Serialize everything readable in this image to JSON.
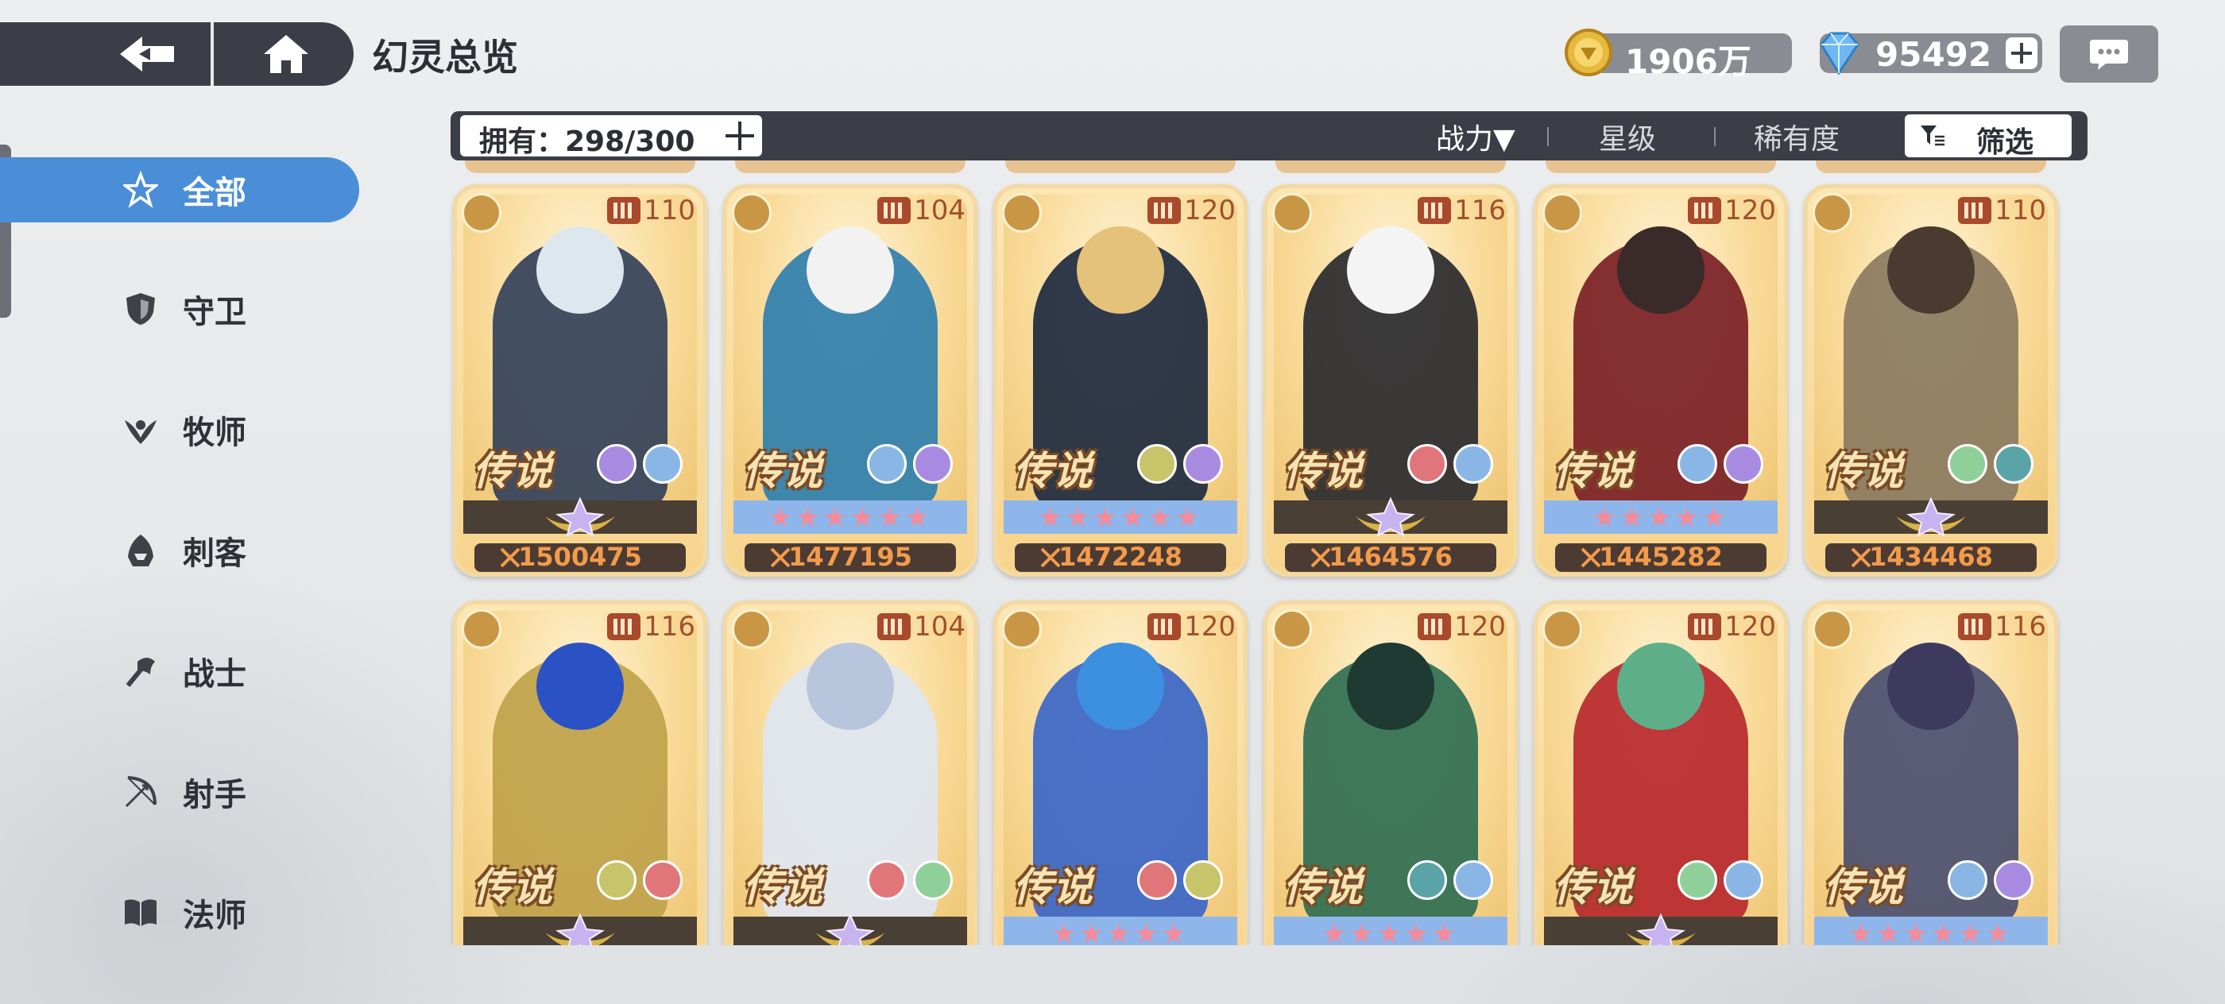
{
  "header": {
    "title": "幻灵总览",
    "gold": "1906万",
    "gems": "95492"
  },
  "sidebar": {
    "items": [
      {
        "label": "全部",
        "icon": "all-icon",
        "active": true
      },
      {
        "label": "守卫",
        "icon": "shield-icon",
        "active": false
      },
      {
        "label": "牧师",
        "icon": "priest-icon",
        "active": false
      },
      {
        "label": "刺客",
        "icon": "assassin-icon",
        "active": false
      },
      {
        "label": "战士",
        "icon": "axe-icon",
        "active": false
      },
      {
        "label": "射手",
        "icon": "bow-icon",
        "active": false
      },
      {
        "label": "法师",
        "icon": "book-icon",
        "active": false
      }
    ]
  },
  "filterbar": {
    "owned": "拥有：298/300",
    "sort_power": "战力▼",
    "sort_star": "星级",
    "sort_rarity": "稀有度",
    "filter": "筛选"
  },
  "cards": [
    {
      "level": "110",
      "rarity": "传说",
      "power": "1500475",
      "class_icon": "priest-icon",
      "tier": "emblem",
      "hair": "#dfe7ee",
      "outfit": "#33415a",
      "elements": [
        "#a88be0",
        "#8ab6e6"
      ]
    },
    {
      "level": "104",
      "rarity": "传说",
      "power": "1477195",
      "class_icon": "shield-icon",
      "tier": "blue",
      "stars": "★★★★★★",
      "hair": "#f2f2f2",
      "outfit": "#2f7fae",
      "elements": [
        "#8ab6e6",
        "#a88be0"
      ]
    },
    {
      "level": "120",
      "rarity": "传说",
      "power": "1472248",
      "class_icon": "axe-icon",
      "tier": "blue",
      "stars": "★★★★★★",
      "hair": "#e4c27a",
      "outfit": "#1e2a3f",
      "elements": [
        "#c8c46a",
        "#a88be0"
      ]
    },
    {
      "level": "116",
      "rarity": "传说",
      "power": "1464576",
      "class_icon": "assassin-icon",
      "tier": "emblem",
      "hair": "#f4f4f4",
      "outfit": "#2a2a2e",
      "elements": [
        "#e0767a",
        "#8ab6e6"
      ]
    },
    {
      "level": "120",
      "rarity": "传说",
      "power": "1445282",
      "class_icon": "bow-icon",
      "tier": "blue",
      "stars": "★★★★★",
      "hair": "#3a2a2a",
      "outfit": "#7a1f26",
      "elements": [
        "#8ab6e6",
        "#a88be0"
      ]
    },
    {
      "level": "110",
      "rarity": "传说",
      "power": "1434468",
      "class_icon": "priest-icon",
      "tier": "emblem",
      "hair": "#4a3a30",
      "outfit": "#8a7a60",
      "elements": [
        "#8fcf9a",
        "#5aa3a6"
      ]
    },
    {
      "level": "116",
      "rarity": "传说",
      "class_icon": "assassin-icon",
      "tier": "emblem",
      "hair": "#2b52c4",
      "outfit": "#bfa24a",
      "elements": [
        "#c8c46a",
        "#e0767a"
      ]
    },
    {
      "level": "104",
      "rarity": "传说",
      "class_icon": "shield-icon",
      "tier": "emblem",
      "hair": "#b7c6dc",
      "outfit": "#dfe6f0",
      "elements": [
        "#e0767a",
        "#8fcf9a"
      ]
    },
    {
      "level": "120",
      "rarity": "传说",
      "class_icon": "book-icon",
      "tier": "blue",
      "stars": "★★★★★",
      "hair": "#3d8fe0",
      "outfit": "#3a66c8",
      "elements": [
        "#e0767a",
        "#c8c46a"
      ]
    },
    {
      "level": "120",
      "rarity": "传说",
      "class_icon": "axe-icon",
      "tier": "blue",
      "stars": "★★★★★",
      "hair": "#1f3a33",
      "outfit": "#2f6e52",
      "elements": [
        "#5aa3a6",
        "#8ab6e6"
      ]
    },
    {
      "level": "120",
      "rarity": "传说",
      "class_icon": "book-icon",
      "tier": "emblem",
      "hair": "#5fae8a",
      "outfit": "#b8282d",
      "elements": [
        "#8fcf9a",
        "#8ab6e6"
      ]
    },
    {
      "level": "116",
      "rarity": "传说",
      "class_icon": "assassin-icon",
      "tier": "blue",
      "stars": "★★★★★★",
      "hair": "#3e3a5e",
      "outfit": "#4b4f70",
      "elements": [
        "#8ab6e6",
        "#a88be0"
      ]
    }
  ]
}
